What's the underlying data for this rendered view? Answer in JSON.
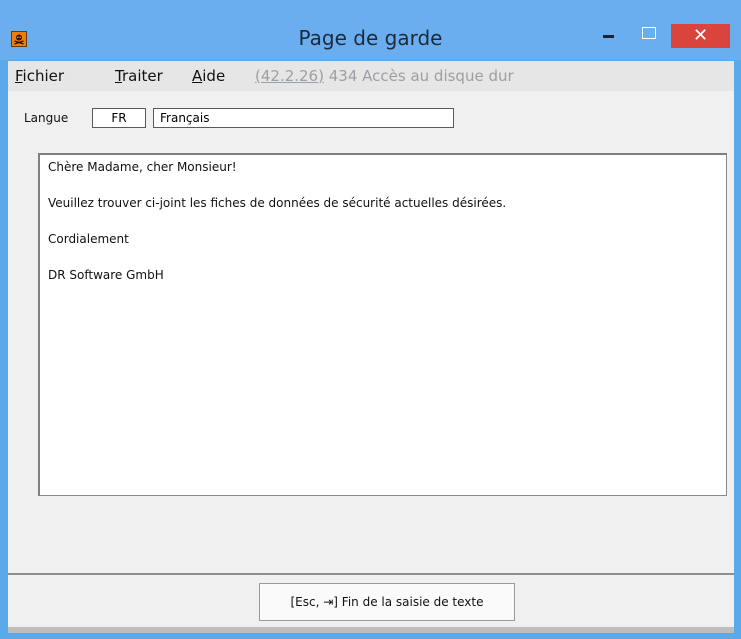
{
  "window": {
    "title": "Page de garde",
    "minimize_label": "–",
    "maximize_label": "",
    "close_label": "✕"
  },
  "menu": {
    "items": [
      {
        "label": "Fichier"
      },
      {
        "label": "Traiter"
      },
      {
        "label": "Aide"
      }
    ],
    "status": "(42.2.26) 434 Accès au disque dur"
  },
  "language": {
    "label": "Langue",
    "code": "FR",
    "name": "Français"
  },
  "letter": {
    "lines": [
      "Chère Madame, cher Monsieur!",
      "Veuillez trouver ci-joint les fiches de données de sécurité actuelles désirées.",
      "Cordialement",
      "DR Software GmbH"
    ]
  },
  "footer": {
    "button_label": "[Esc, ⇥] Fin de la saisie de texte"
  },
  "colors": {
    "titlebar": "#6aaef0",
    "close_button": "#d9453c",
    "app_icon": "#f07d0a"
  }
}
